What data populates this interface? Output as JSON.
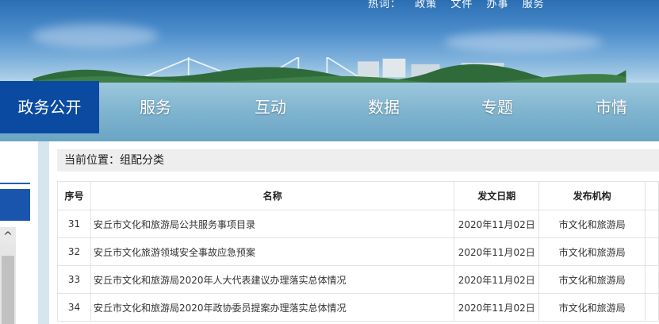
{
  "header": {
    "links": [
      "热词：",
      "政策",
      "文件",
      "办事",
      "服务"
    ]
  },
  "nav": {
    "items": [
      "政务公开",
      "服务",
      "互动",
      "数据",
      "专题",
      "市情"
    ],
    "active_color": "#0b4aa1"
  },
  "sidebar": {
    "scroll_up_glyph": "^"
  },
  "breadcrumb": {
    "text": "当前位置：组配分类"
  },
  "table": {
    "headers": [
      "序号",
      "名称",
      "发文日期",
      "发布机构"
    ],
    "rows": [
      {
        "no": "31",
        "name": "安丘市文化和旅游局公共服务事项目录",
        "date": "2020年11月02日",
        "org": "市文化和旅游局"
      },
      {
        "no": "32",
        "name": "安丘市文化旅游领域安全事故应急预案",
        "date": "2020年11月02日",
        "org": "市文化和旅游局"
      },
      {
        "no": "33",
        "name": "安丘市文化和旅游局2020年人大代表建议办理落实总体情况",
        "date": "2020年11月02日",
        "org": "市文化和旅游局"
      },
      {
        "no": "34",
        "name": "安丘市文化和旅游局2020年政协委员提案办理落实总体情况",
        "date": "2020年11月02日",
        "org": "市文化和旅游局"
      }
    ]
  }
}
